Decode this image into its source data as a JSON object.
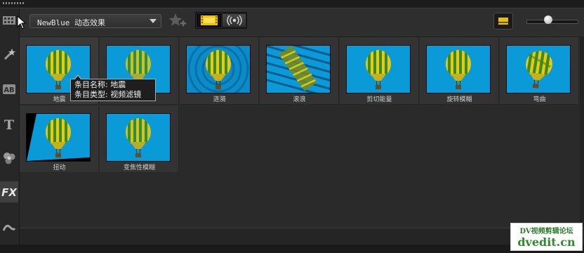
{
  "toolbar": {
    "library_dropdown": {
      "selected": "NewBlue 动态效果"
    },
    "add_to_favorites_icon": "star-add-icon",
    "view_toggle": {
      "video_icon": "filmstrip-icon",
      "audio_icon": "audio-wave-icon",
      "active": "video"
    },
    "display_options_icon": "panel-icon",
    "thumbnail_size_slider": {
      "value": 0.4
    }
  },
  "sidebar": {
    "items": [
      {
        "name": "media",
        "icon": "media-library-icon"
      },
      {
        "name": "instant-project",
        "icon": "magic-wand-icon"
      },
      {
        "name": "transitions",
        "icon": "transition-ab-icon"
      },
      {
        "name": "titles",
        "icon": "title-t-icon"
      },
      {
        "name": "graphics",
        "icon": "graphics-icon"
      },
      {
        "name": "filters",
        "icon": "fx-icon",
        "active": true
      },
      {
        "name": "path",
        "icon": "path-icon"
      }
    ]
  },
  "library": {
    "items": [
      {
        "label": "地震",
        "variant": "quake",
        "selected": true
      },
      {
        "label": "",
        "variant": "blur"
      },
      {
        "label": "涟漪",
        "variant": "ripple"
      },
      {
        "label": "滚浪",
        "variant": "waves"
      },
      {
        "label": "剪切能量",
        "variant": "shear"
      },
      {
        "label": "旋转模糊",
        "variant": "spin"
      },
      {
        "label": "弯曲",
        "variant": "bend"
      },
      {
        "label": "扭动",
        "variant": "twist"
      },
      {
        "label": "变焦性模糊",
        "variant": "zoom"
      }
    ]
  },
  "tooltip": {
    "line1": "条目名称: 地震",
    "line2": "条目类型: 视频滤镜"
  },
  "watermark": {
    "line1": "DV视频剪辑论坛",
    "line2": "dvedit.cn"
  },
  "colors": {
    "accent_yellow": "#f2c200",
    "thumbnail_sky": "#0a9ad8",
    "balloon_yellow": "#e3c919",
    "balloon_green": "#3f8a1c"
  }
}
